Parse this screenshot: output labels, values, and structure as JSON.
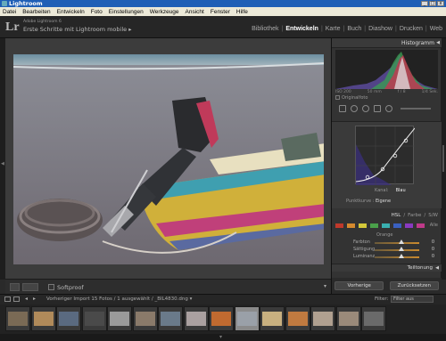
{
  "window": {
    "title": "Lightroom"
  },
  "menu": [
    "Datei",
    "Bearbeiten",
    "Entwickeln",
    "Foto",
    "Einstellungen",
    "Werkzeuge",
    "Ansicht",
    "Fenster",
    "Hilfe"
  ],
  "identity": {
    "logo": "Lr",
    "catalog_small": "Adobe Lightroom 6",
    "catalog_title": "Erste Schritte mit Lightroom mobile ▸"
  },
  "modules": [
    {
      "label": "Bibliothek",
      "active": false
    },
    {
      "label": "Entwickeln",
      "active": true
    },
    {
      "label": "Karte",
      "active": false
    },
    {
      "label": "Buch",
      "active": false
    },
    {
      "label": "Diashow",
      "active": false
    },
    {
      "label": "Drucken",
      "active": false
    },
    {
      "label": "Web",
      "active": false
    }
  ],
  "module_sep": "|",
  "toolbar": {
    "softproof_label": "Softproof",
    "dropdown_glyph": "▾"
  },
  "right_panel": {
    "histogram_title": "Histogramm",
    "histogram_info": [
      "ISO 200",
      "50 mm",
      "f / 8",
      "1/4 Sek."
    ],
    "original_photo_label": "Originalfoto",
    "curve_channel_labels": [
      "Kanal:",
      "Blau"
    ],
    "point_curve_label": "Punktkurve :",
    "point_curve_value": "Eigene",
    "hsl_tabs": [
      "HSL",
      "/",
      "Farbe",
      "/",
      "S/W"
    ],
    "hsl_active": "HSL",
    "hsl_all": "Alle",
    "orange_label": "Orange",
    "adjustments": [
      {
        "label": "Farbton",
        "value": "0",
        "knob": 0.55
      },
      {
        "label": "Sättigung",
        "value": "0",
        "knob": 0.55
      },
      {
        "label": "Luminanz",
        "value": "0",
        "knob": 0.55
      }
    ],
    "tone_curve_footer": "Teiltonung",
    "buttons": {
      "previous": "Vorherige",
      "reset": "Zurücksetzen"
    }
  },
  "filmstrip": {
    "info": "Vorheriger Import   15 Fotos / 1 ausgewählt / _BIL4830.dng ▾",
    "filter_label": "Filter:",
    "filter_value": "Filter aus",
    "selected_index": 9
  },
  "colors": {
    "titlebar": "#1f5fb6",
    "panel_bg": "#333333",
    "accent_active": "#ffffff"
  }
}
